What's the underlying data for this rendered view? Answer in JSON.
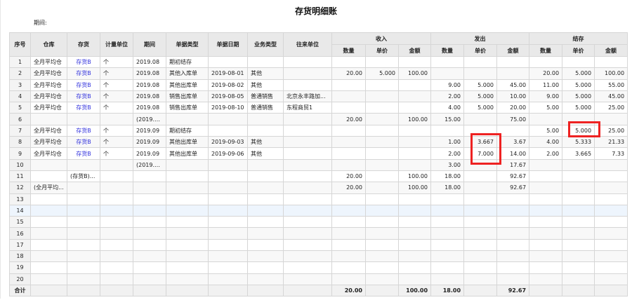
{
  "title": "存货明细账",
  "period_label": "期间:",
  "headers": {
    "seq": "序号",
    "warehouse": "仓库",
    "item": "存货",
    "unit": "计量单位",
    "period": "期间",
    "doc_type": "单据类型",
    "doc_date": "单据日期",
    "biz_type": "业务类型",
    "partner": "往来单位",
    "in": "收入",
    "out": "发出",
    "balance": "结存",
    "qty": "数量",
    "price": "单价",
    "amount": "金额"
  },
  "rows": [
    [
      "1",
      "全月平均仓",
      "存货B",
      "个",
      "2019.08",
      "期初结存",
      "",
      "",
      "",
      "",
      "",
      "",
      "",
      "",
      "",
      "",
      "",
      ""
    ],
    [
      "2",
      "全月平均仓",
      "存货B",
      "个",
      "2019.08",
      "其他入库单",
      "2019-08-01",
      "其他",
      "",
      "20.00",
      "5.000",
      "100.00",
      "",
      "",
      "",
      "20.00",
      "5.000",
      "100.00"
    ],
    [
      "3",
      "全月平均仓",
      "存货B",
      "个",
      "2019.08",
      "其他出库单",
      "2019-08-02",
      "其他",
      "",
      "",
      "",
      "",
      "9.00",
      "5.000",
      "45.00",
      "11.00",
      "5.000",
      "55.00"
    ],
    [
      "4",
      "全月平均仓",
      "存货B",
      "个",
      "2019.08",
      "销售出库单",
      "2019-08-05",
      "普通销售",
      "北京永丰路加...",
      "",
      "",
      "",
      "2.00",
      "5.000",
      "10.00",
      "9.00",
      "5.000",
      "45.00"
    ],
    [
      "5",
      "全月平均仓",
      "存货B",
      "个",
      "2019.08",
      "销售出库单",
      "2019-08-10",
      "普通销售",
      "东程商贸1",
      "",
      "",
      "",
      "4.00",
      "5.000",
      "20.00",
      "5.00",
      "5.000",
      "25.00"
    ],
    [
      "6",
      "",
      "",
      "",
      "(2019.0...",
      "",
      "",
      "",
      "",
      "20.00",
      "",
      "100.00",
      "15.00",
      "",
      "75.00",
      "",
      "",
      ""
    ],
    [
      "7",
      "全月平均仓",
      "存货B",
      "个",
      "2019.09",
      "期初结存",
      "",
      "",
      "",
      "",
      "",
      "",
      "",
      "",
      "",
      "5.00",
      "5.000",
      "25.00"
    ],
    [
      "8",
      "全月平均仓",
      "存货B",
      "个",
      "2019.09",
      "其他出库单",
      "2019-09-03",
      "其他",
      "",
      "",
      "",
      "",
      "1.00",
      "3.667",
      "3.67",
      "4.00",
      "5.333",
      "21.33"
    ],
    [
      "9",
      "全月平均仓",
      "存货B",
      "个",
      "2019.09",
      "其他出库单",
      "2019-09-06",
      "其他",
      "",
      "",
      "",
      "",
      "2.00",
      "7.000",
      "14.00",
      "2.00",
      "3.665",
      "7.33"
    ],
    [
      "10",
      "",
      "",
      "",
      "(2019.0...",
      "",
      "",
      "",
      "",
      "",
      "",
      "",
      "3.00",
      "",
      "17.67",
      "",
      "",
      ""
    ],
    [
      "11",
      "",
      "(存货B)...",
      "",
      "",
      "",
      "",
      "",
      "",
      "20.00",
      "",
      "100.00",
      "18.00",
      "",
      "92.67",
      "",
      "",
      ""
    ],
    [
      "12",
      "(全月平均...",
      "",
      "",
      "",
      "",
      "",
      "",
      "",
      "20.00",
      "",
      "100.00",
      "18.00",
      "",
      "92.67",
      "",
      "",
      ""
    ],
    [
      "13",
      "",
      "",
      "",
      "",
      "",
      "",
      "",
      "",
      "",
      "",
      "",
      "",
      "",
      "",
      "",
      "",
      ""
    ],
    [
      "14",
      "",
      "",
      "",
      "",
      "",
      "",
      "",
      "",
      "",
      "",
      "",
      "",
      "",
      "",
      "",
      "",
      ""
    ],
    [
      "15",
      "",
      "",
      "",
      "",
      "",
      "",
      "",
      "",
      "",
      "",
      "",
      "",
      "",
      "",
      "",
      "",
      ""
    ],
    [
      "16",
      "",
      "",
      "",
      "",
      "",
      "",
      "",
      "",
      "",
      "",
      "",
      "",
      "",
      "",
      "",
      "",
      ""
    ],
    [
      "17",
      "",
      "",
      "",
      "",
      "",
      "",
      "",
      "",
      "",
      "",
      "",
      "",
      "",
      "",
      "",
      "",
      ""
    ],
    [
      "18",
      "",
      "",
      "",
      "",
      "",
      "",
      "",
      "",
      "",
      "",
      "",
      "",
      "",
      "",
      "",
      "",
      ""
    ],
    [
      "19",
      "",
      "",
      "",
      "",
      "",
      "",
      "",
      "",
      "",
      "",
      "",
      "",
      "",
      "",
      "",
      "",
      ""
    ],
    [
      "20",
      "",
      "",
      "",
      "",
      "",
      "",
      "",
      "",
      "",
      "",
      "",
      "",
      "",
      "",
      "",
      "",
      ""
    ]
  ],
  "total": [
    "合计",
    "",
    "",
    "",
    "",
    "",
    "",
    "",
    "",
    "20.00",
    "",
    "100.00",
    "18.00",
    "",
    "92.67",
    "",
    "",
    ""
  ]
}
